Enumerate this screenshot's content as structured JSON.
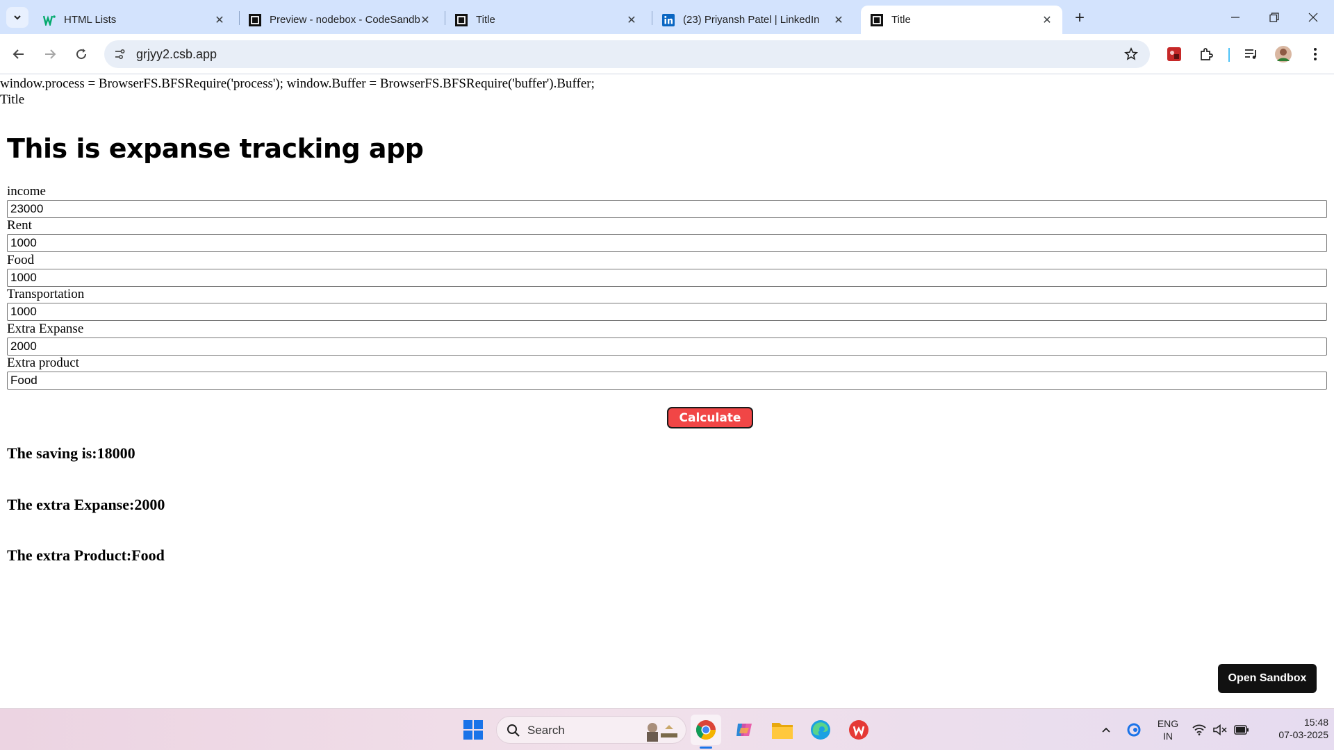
{
  "browser": {
    "tabs": [
      {
        "label": "HTML Lists",
        "favicon": "w3schools-icon",
        "active": false
      },
      {
        "label": "Preview - nodebox - CodeSandbox",
        "favicon": "codesandbox-icon",
        "active": false
      },
      {
        "label": "Title",
        "favicon": "codesandbox-icon",
        "active": false
      },
      {
        "label": "(23) Priyansh Patel | LinkedIn",
        "favicon": "linkedin-icon",
        "active": false
      },
      {
        "label": "Title",
        "favicon": "codesandbox-icon",
        "active": true
      }
    ],
    "url": "grjyy2.csb.app"
  },
  "page": {
    "script_text": "window.process = BrowserFS.BFSRequire('process'); window.Buffer = BrowserFS.BFSRequire('buffer').Buffer;",
    "title_text": "Title",
    "heading": "This is expanse tracking app",
    "fields": [
      {
        "label": "income",
        "value": "23000"
      },
      {
        "label": "Rent",
        "value": "1000"
      },
      {
        "label": "Food",
        "value": "1000"
      },
      {
        "label": "Transportation",
        "value": "1000"
      },
      {
        "label": "Extra Expanse",
        "value": "2000"
      },
      {
        "label": "Extra product",
        "value": "Food"
      }
    ],
    "calculate_label": "Calculate",
    "results": {
      "saving": "The saving is:18000",
      "extra_expanse": "The extra Expanse:2000",
      "extra_product": "The extra Product:Food"
    },
    "open_sandbox_label": "Open Sandbox"
  },
  "taskbar": {
    "search_label": "Search",
    "language": "ENG",
    "region": "IN",
    "time": "15:48",
    "date": "07-03-2025"
  },
  "colors": {
    "tabstrip": "#d3e3fd",
    "calculate_button": "#f14646",
    "open_sandbox": "#111111"
  }
}
